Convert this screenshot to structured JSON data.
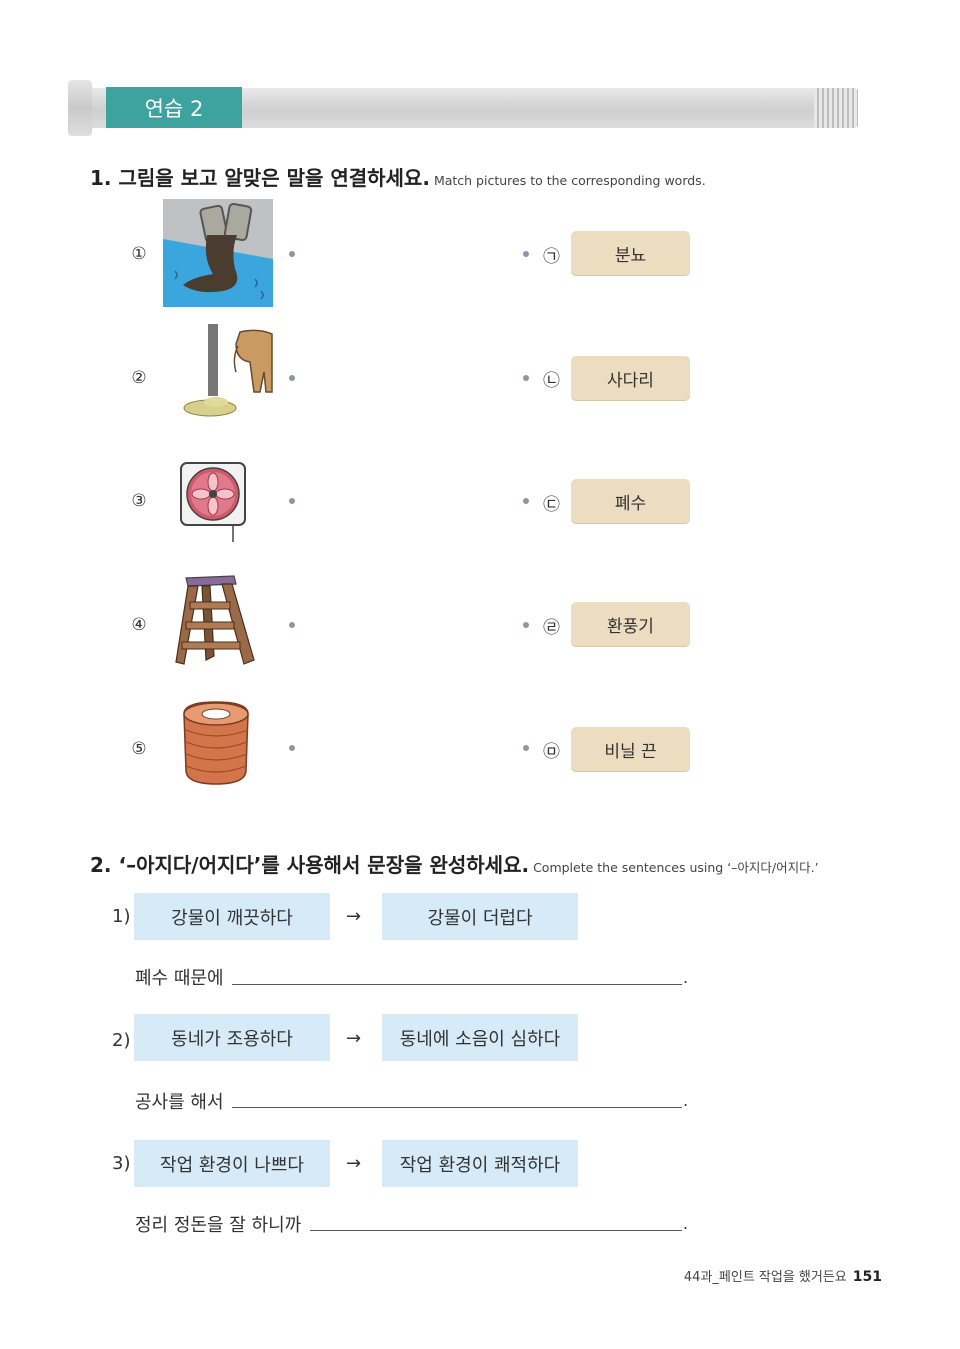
{
  "section_label": "연습 2",
  "q1": {
    "title": "1. 그림을 보고 알맞은 말을 연결하세요.",
    "subtitle": "Match pictures to the corresponding words.",
    "rows": [
      {
        "num": "①",
        "picture": "wastewater-pipes-icon",
        "mark": "㉠",
        "word": "분뇨"
      },
      {
        "num": "②",
        "picture": "cow-dung-icon",
        "mark": "㉡",
        "word": "사다리"
      },
      {
        "num": "③",
        "picture": "ventilation-fan-icon",
        "mark": "㉢",
        "word": "폐수"
      },
      {
        "num": "④",
        "picture": "ladder-icon",
        "mark": "㉣",
        "word": "환풍기"
      },
      {
        "num": "⑤",
        "picture": "vinyl-string-icon",
        "mark": "㉤",
        "word": "비닐 끈"
      }
    ]
  },
  "q2": {
    "title": "2. ‘–아지다/어지다’를 사용해서 문장을 완성하세요.",
    "subtitle": "Complete the sentences using ‘–아지다/어지다.’",
    "arrow": "→",
    "items": [
      {
        "no": "1)",
        "from": "강물이 깨끗하다",
        "to": "강물이 더럽다",
        "prompt": "폐수 때문에",
        "end": "."
      },
      {
        "no": "2)",
        "from": "동네가 조용하다",
        "to": "동네에 소음이 심하다",
        "prompt": "공사를 해서",
        "end": "."
      },
      {
        "no": "3)",
        "from": "작업 환경이 나쁘다",
        "to": "작업 환경이 쾌적하다",
        "prompt": "정리 정돈을 잘 하니까",
        "end": "."
      }
    ]
  },
  "footer": {
    "lesson": "44과_페인트 작업을 했거든요",
    "page": "151"
  }
}
